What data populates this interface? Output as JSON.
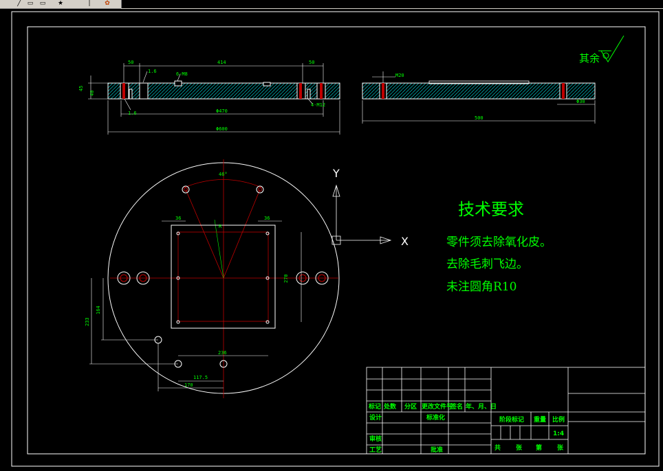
{
  "toolbar": {
    "icons": [
      "line-tool-icon",
      "rectangle-tool-icon",
      "star-tool-icon",
      "text-cursor-icon",
      "paint-icon"
    ]
  },
  "drawing": {
    "roughness": "其余",
    "tech_title": "技术要求",
    "tech_lines": [
      "零件须去除氧化皮。",
      "去除毛刺飞边。",
      "未注圆角R10"
    ],
    "axis_y": "Y",
    "axis_x": "X",
    "dims": {
      "d50a": "50",
      "d414": "414",
      "d50b": "50",
      "d16": "1.6",
      "d6m": "6-M8",
      "d470": "Φ470",
      "d600": "Φ600",
      "d4m12": "4-M12",
      "dm20": "M20",
      "d500": "500",
      "d30": "Φ30",
      "d45": "45",
      "d40": "40",
      "d16b": "1.6",
      "d46": "46°",
      "d36a": "36",
      "d36b": "36",
      "d270": "270",
      "d164": "164",
      "d233": "233",
      "d236": "236",
      "d1175": "117.5",
      "d170": "170",
      "dr": "R"
    }
  },
  "title_block": {
    "row1": [
      "标记",
      "处数",
      "分区",
      "更改文件号",
      "签名",
      "年、月、日"
    ],
    "design": "设计",
    "standardize": "标准化",
    "stage_mark": "阶段标记",
    "weight": "重量",
    "scale": "比例",
    "scale_value": "1:4",
    "review": "审核",
    "process": "工艺",
    "approve": "批准",
    "total": "共",
    "sheet": "张",
    "page": "第",
    "sheet2": "张"
  }
}
